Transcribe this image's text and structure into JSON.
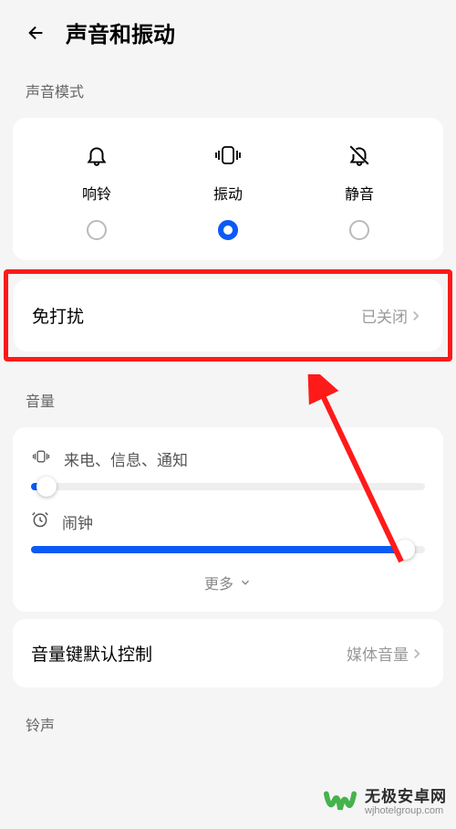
{
  "header": {
    "title": "声音和振动"
  },
  "soundMode": {
    "sectionLabel": "声音模式",
    "items": [
      {
        "label": "响铃"
      },
      {
        "label": "振动"
      },
      {
        "label": "静音"
      }
    ]
  },
  "dnd": {
    "label": "免打扰",
    "value": "已关闭"
  },
  "volume": {
    "sectionLabel": "音量",
    "items": [
      {
        "label": "来电、信息、通知",
        "percent": 4
      },
      {
        "label": "闹钟",
        "percent": 95
      }
    ],
    "moreLabel": "更多"
  },
  "volumeKey": {
    "label": "音量键默认控制",
    "value": "媒体音量"
  },
  "ringtone": {
    "sectionLabel": "铃声"
  },
  "watermark": {
    "cn": "无极安卓网",
    "en": "wjhotelgroup.com"
  }
}
